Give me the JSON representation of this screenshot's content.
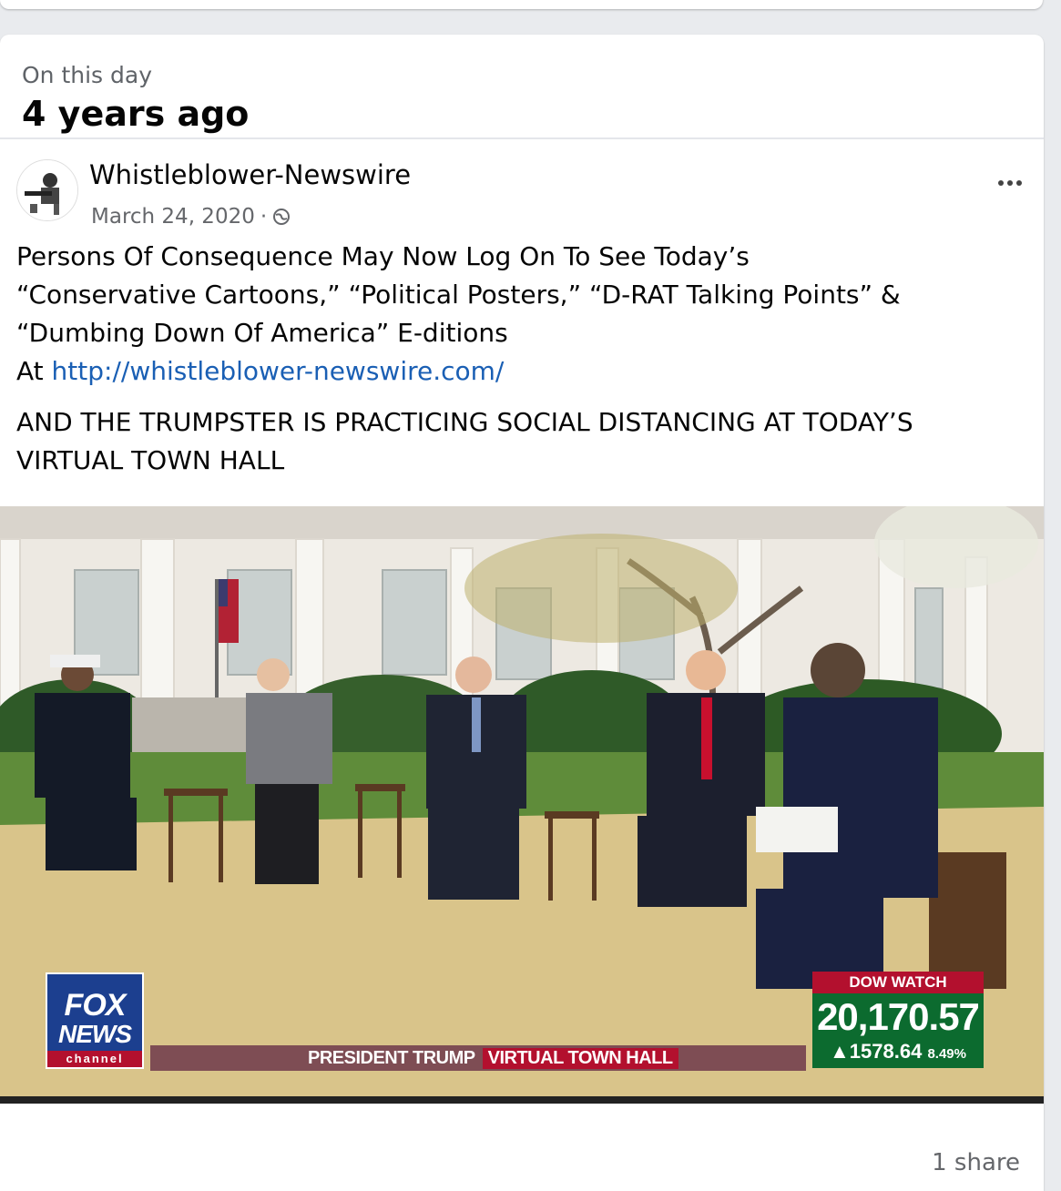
{
  "memory": {
    "kicker": "On this day",
    "title": "4 years ago"
  },
  "post": {
    "author": "Whistleblower-Newswire",
    "date": "March 24, 2020",
    "separator": "·",
    "line1": "Persons Of Consequence May Now Log On To See Today’s",
    "line2": "“Conservative Cartoons,” “Political Posters,” “D-RAT Talking Points” &",
    "line3": "“Dumbing Down Of America” E-ditions",
    "line4_prefix": "At ",
    "link": "http://whistleblower-newswire.com/",
    "para2_line1": "AND THE TRUMPSTER IS PRACTICING SOCIAL DISTANCING AT TODAY’S",
    "para2_line2": "VIRTUAL TOWN HALL"
  },
  "media": {
    "logo": {
      "line1": "FOX",
      "line2": "NEWS",
      "line3": "channel"
    },
    "ticker": {
      "part1": "PRESIDENT TRUMP",
      "part2": "VIRTUAL TOWN HALL"
    },
    "dow": {
      "title": "DOW WATCH",
      "value": "20,170.57",
      "change": "▲1578.64",
      "pct": "8.49%"
    }
  },
  "footer": {
    "shares": "1 share"
  },
  "icons": {
    "more": "more-options-icon",
    "privacy": "globe-icon"
  }
}
